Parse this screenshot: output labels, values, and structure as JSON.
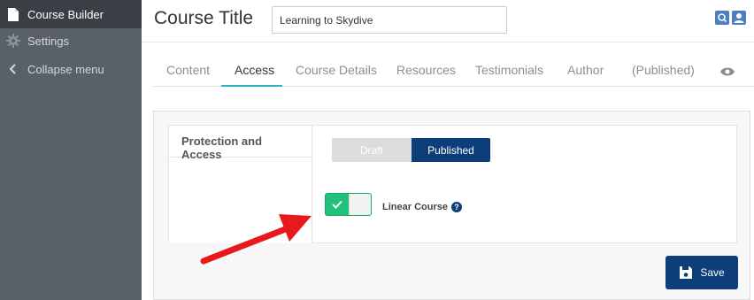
{
  "sidebar": {
    "items": [
      {
        "label": "Course Builder",
        "icon": "document-icon",
        "active": true
      },
      {
        "label": "Settings",
        "icon": "gear-icon",
        "active": false
      },
      {
        "label": "Collapse menu",
        "icon": "chevron-left-icon",
        "active": false
      }
    ]
  },
  "header": {
    "title": "Course Title",
    "title_input_value": "Learning to Skydive"
  },
  "tabs": [
    {
      "label": "Content"
    },
    {
      "label": "Access"
    },
    {
      "label": "Course Details"
    },
    {
      "label": "Resources"
    },
    {
      "label": "Testimonials"
    },
    {
      "label": "Author"
    },
    {
      "label": "(Published)"
    }
  ],
  "panel": {
    "section_title": "Protection and Access",
    "status": {
      "draft_label": "Draft",
      "published_label": "Published",
      "selected": "Published"
    },
    "linear_course": {
      "label": "Linear Course",
      "enabled": true,
      "help": "?"
    },
    "save_label": "Save"
  },
  "colors": {
    "sidebar_bg": "#5a6069",
    "sidebar_active_bg": "#3a3f46",
    "accent_tab": "#2bb3c0",
    "primary": "#0d3e7a",
    "toggle_on": "#21c17a",
    "annotation_arrow": "#e8191c"
  }
}
